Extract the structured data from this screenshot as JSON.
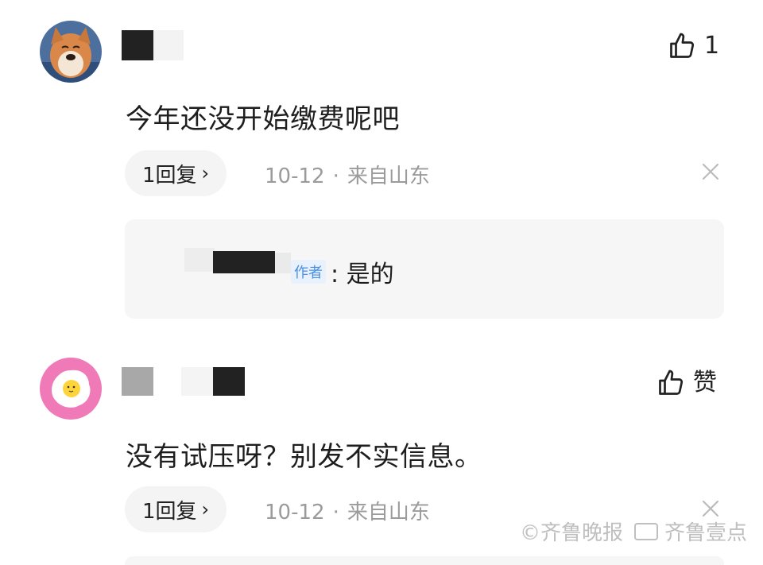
{
  "comments": [
    {
      "text": "今年还没开始缴费呢吧",
      "like_count": "1",
      "reply_label": "1回复",
      "date": "10-12",
      "separator": "·",
      "location": "来自山东",
      "sub_reply": {
        "author_tag": "作者",
        "text": ": 是的"
      }
    },
    {
      "text": "没有试压呀？别发不实信息。",
      "like_label": "赞",
      "reply_label": "1回复",
      "date": "10-12",
      "separator": "·",
      "location": "来自山东"
    }
  ],
  "watermark": {
    "left_text": "©齐鲁晚报",
    "right_text": "齐鲁壹点"
  },
  "colors": {
    "text": "#1e1e1e",
    "meta": "#9b9b9b",
    "pill_bg": "#f4f4f4",
    "sub_box_bg": "#f6f6f6",
    "author_tag": "#4a90e2",
    "avatar2_bg": "#f07ab8"
  }
}
